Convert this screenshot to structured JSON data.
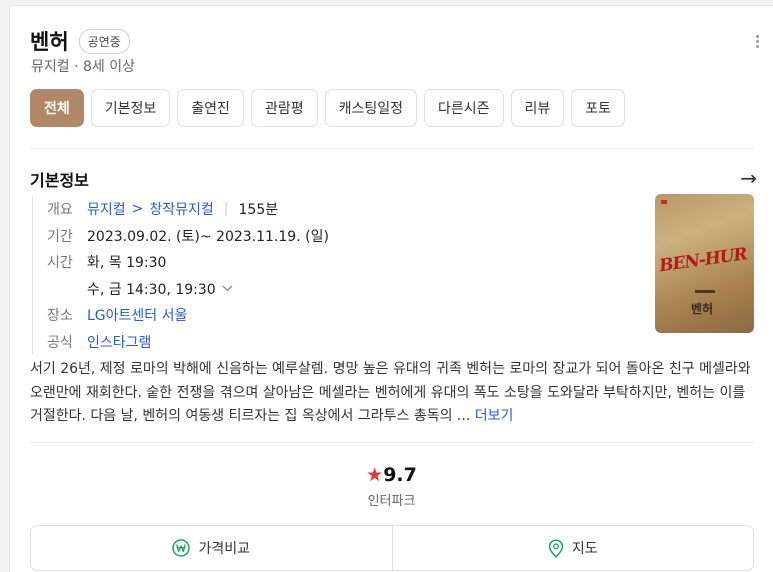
{
  "header": {
    "title": "벤허",
    "badge": "공연중",
    "subtitle": "뮤지컬 · 8세 이상"
  },
  "tabs": [
    {
      "label": "전체",
      "active": true
    },
    {
      "label": "기본정보"
    },
    {
      "label": "출연진"
    },
    {
      "label": "관람평"
    },
    {
      "label": "캐스팅일정"
    },
    {
      "label": "다른시즌"
    },
    {
      "label": "리뷰"
    },
    {
      "label": "포토"
    }
  ],
  "basic_info": {
    "title": "기본정보",
    "overview_label": "개요",
    "genre_1": "뮤지컬",
    "genre_sep": ">",
    "genre_2": "창작뮤지컬",
    "runtime": "155분",
    "period_label": "기간",
    "period": "2023.09.02. (토)~ 2023.11.19. (일)",
    "time_label": "시간",
    "time_1": "화, 목 19:30",
    "time_2": "수, 금 14:30, 19:30",
    "venue_label": "장소",
    "venue": "LG아트센터 서울",
    "official_label": "공식",
    "official": "인스타그램"
  },
  "poster": {
    "logo_text": "BEN-HUR",
    "korean_title": "벤허"
  },
  "description": {
    "text": "서기 26년, 제정 로마의 박해에 신음하는 예루살렘. 명망 높은 유대의 귀족 벤허는 로마의 장교가 되어 돌아온 친구 메셀라와 오랜만에 재회한다. 숱한 전쟁을 겪으며 살아남은 메셀라는 벤허에게 유대의 폭도 소탕을 도와달라 부탁하지만, 벤허는 이를 거절한다. 다음 날, 벤허의 여동생 티르자는 집 옥상에서 그라투스 총독의 ...",
    "more": "더보기"
  },
  "rating": {
    "star": "★",
    "score": "9.7",
    "source": "인터파크"
  },
  "actions": {
    "price_compare": "가격비교",
    "map": "지도"
  },
  "colors": {
    "accent_tab": "#b08868",
    "link": "#2a5bd7",
    "star": "#e53935",
    "price_icon": "#1fa35c",
    "map_icon": "#1fa35c"
  }
}
